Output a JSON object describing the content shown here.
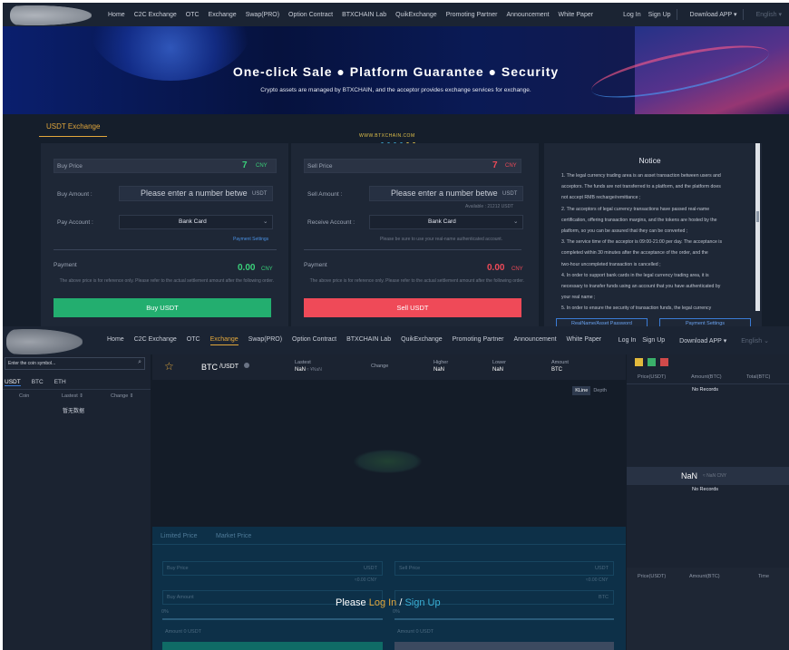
{
  "top": {
    "nav": {
      "menu": [
        "Home",
        "C2C Exchange",
        "OTC",
        "Exchange",
        "Swap(PRO)",
        "Option Contract",
        "BTXCHAIN Lab",
        "QuikExchange",
        "Promoting Partner",
        "Announcement",
        "White Paper"
      ],
      "login": "Log In",
      "signup": "Sign Up",
      "download": "Download APP",
      "language": "English"
    },
    "banner": {
      "title": "One-click Sale ● Platform Guarantee ● Security",
      "subtitle": "Crypto assets are managed by BTXCHAIN, and the acceptor provides exchange services for exchange."
    },
    "tab": "USDT Exchange",
    "domain": "WWW.BTXCHAIN.COM",
    "buy": {
      "price_label": "Buy Price",
      "price": "7",
      "currency": "CNY",
      "amount_label": "Buy Amount :",
      "amount_placeholder": "Please enter a number betwe",
      "amount_unit": "USDT",
      "account_label": "Pay Account :",
      "account_value": "Bank Card",
      "payment_settings": "Payment Settings",
      "payment_label": "Payment",
      "payment_value": "0.00",
      "note": "The above price is for reference only. Please refer to the actual settlement amount after the following order.",
      "button": "Buy USDT"
    },
    "sell": {
      "price_label": "Sell Price",
      "price": "7",
      "currency": "CNY",
      "amount_label": "Sell Amount :",
      "amount_placeholder": "Please enter a number betwe",
      "amount_unit": "USDT",
      "available": "Available : 21212 USDT",
      "account_label": "Receive Account :",
      "account_value": "Bank Card",
      "hint": "Please be sure to use your real-name authenticated account.",
      "payment_label": "Payment",
      "payment_value": "0.00",
      "note": "The above price is for reference only. Please refer to the actual settlement amount after the following order.",
      "button": "Sell USDT"
    },
    "notice": {
      "title": "Notice",
      "lines": [
        "1. The legal currency trading area is an asset transaction between users and",
        "acceptors. The funds are not transferred to a platform, and the platform does",
        "not accept RMB recharge/remittance ;",
        "2. The acceptors of legal currency transactions have passed real-name",
        "certification, offering transaction margins, and the tokens are hosted by the",
        "platform, so you can be assured that they can be converted ;",
        "3. The service time of the acceptor is 09:00-21:00 per day. The acceptance is",
        "completed within 30 minutes after the acceptance of the order, and the",
        "two-hour uncompleted transaction is cancelled ;",
        "4. In order to support bank cards in the legal currency trading area, it is",
        "necessary to transfer funds using an account that you have authenticated by",
        "your real name ;",
        "5. In order to ensure the security of transaction funds, the legal currency"
      ],
      "btn_password": "RealName/Asset Password",
      "btn_payment": "Payment Settings"
    }
  },
  "bottom": {
    "nav": {
      "menu": [
        "Home",
        "C2C Exchange",
        "OTC",
        "Exchange",
        "Swap(PRO)",
        "Option Contract",
        "BTXCHAIN Lab",
        "QuikExchange",
        "Promoting Partner",
        "Announcement",
        "White Paper"
      ],
      "active_index": 3,
      "login": "Log In",
      "signup": "Sign Up",
      "download": "Download APP",
      "language": "English"
    },
    "search_placeholder": "Enter the coin symbol...",
    "market_tabs": [
      "USDT",
      "BTC",
      "ETH"
    ],
    "market_head": {
      "coin": "Coin",
      "latest": "Lastest ⇕",
      "change": "Change ⇕"
    },
    "no_data": "暂无数据",
    "pair": {
      "base": "BTC",
      "quote": "/USDT"
    },
    "ticker": {
      "latest_label": "Lastest",
      "latest_value": "NaN",
      "latest_cny": "≈ ¥NaN",
      "change_label": "Change",
      "higher_label": "Higher",
      "higher_value": "NaN",
      "lower_label": "Lower",
      "lower_value": "NaN",
      "amount_label": "Amount",
      "amount_value": "BTC"
    },
    "chart_tabs": [
      "KLine",
      "Depth"
    ],
    "order_tabs": [
      "Limited Price",
      "Market Price"
    ],
    "order": {
      "buy_price": "Buy Price",
      "sell_price": "Sell Price",
      "unit_usdt": "USDT",
      "cny_buy": "≈0.00 CNY",
      "cny_sell": "≈0.00 CNY",
      "buy_amount": "Buy Amount",
      "unit_btc": "BTC",
      "pct_left": "0%",
      "pct_right": "0%",
      "amount_usdt": "Amount 0 USDT",
      "amount_usdt_right": "Amount 0 USDT"
    },
    "login_prompt": {
      "pre": "Please ",
      "login": "Log In",
      "sep": " / ",
      "signup": "Sign Up"
    },
    "orderbook": {
      "cols": [
        "Price(USDT)",
        "Amount(BTC)",
        "Total(BTC)"
      ],
      "no_records_1": "No Records",
      "mid_price": "NaN",
      "mid_cny": "≈ NaN CNY",
      "no_records_2": "No Records",
      "trade_cols": [
        "Price(USDT)",
        "Amount(BTC)",
        "Time"
      ]
    }
  }
}
